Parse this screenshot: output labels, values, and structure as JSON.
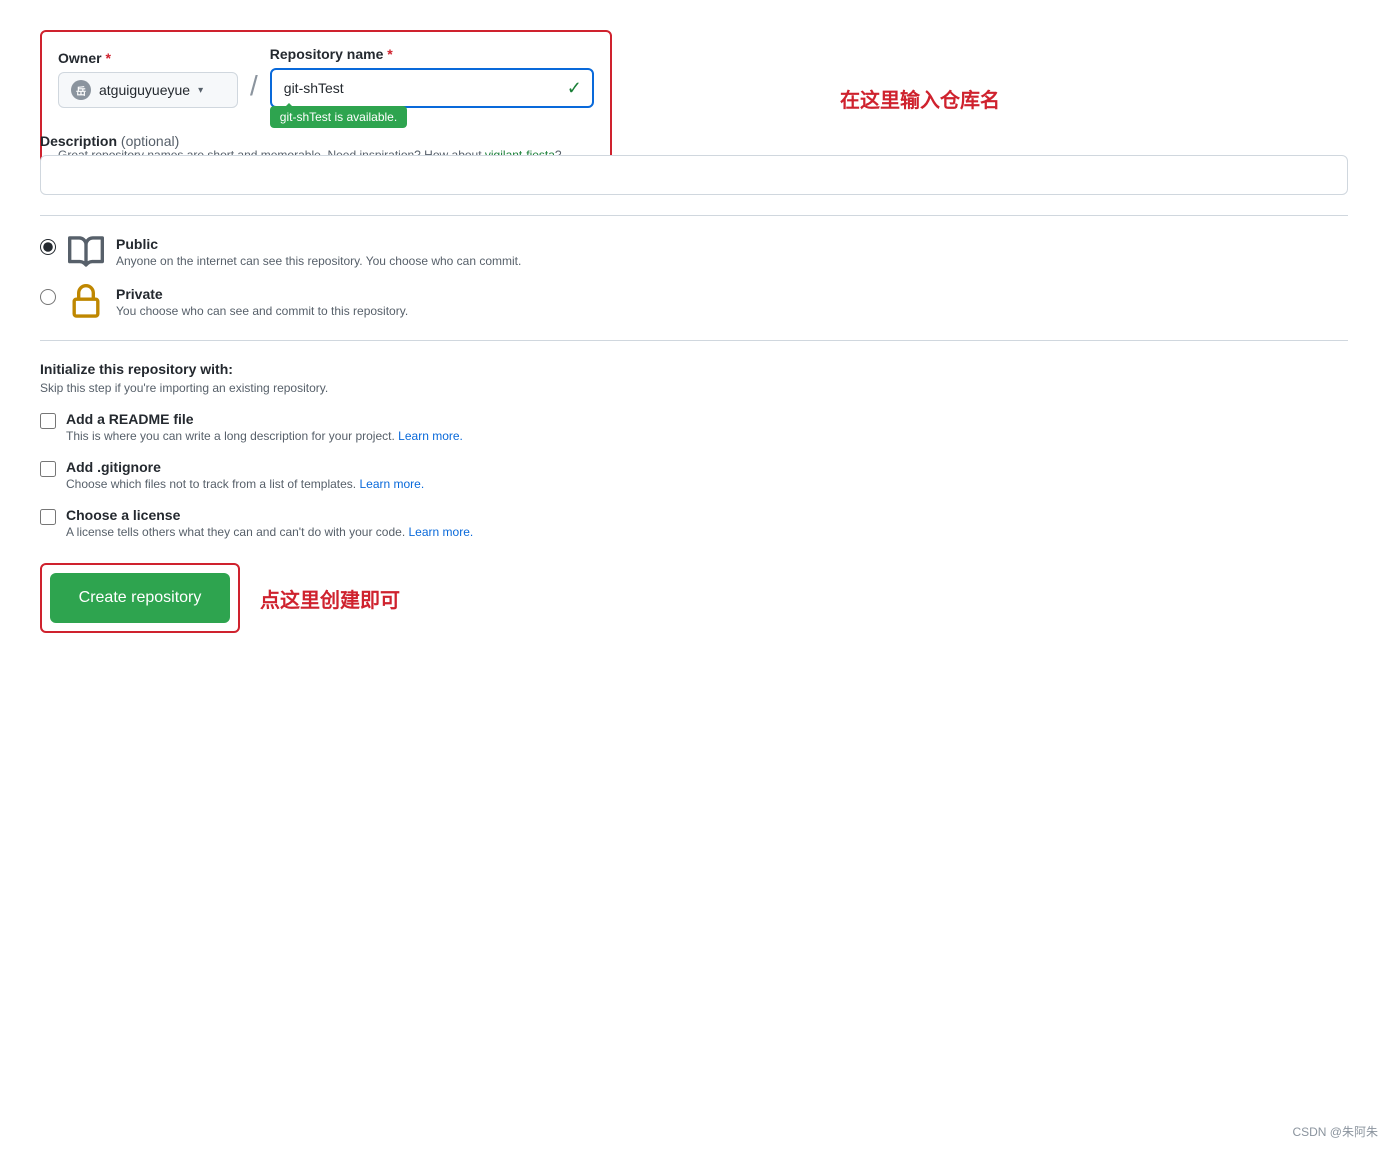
{
  "owner": {
    "label": "Owner",
    "required": true,
    "avatar_char": "岳",
    "username": "atguiguyueyue",
    "dropdown_aria": "Owner dropdown"
  },
  "repo_name": {
    "label": "Repository name",
    "required": true,
    "value": "git-shTest",
    "available_message": "git-shTest is available.",
    "hint_prefix": "Great repository names are short and memorable. Need inspiration? How about ",
    "suggestion": "vigilant-fiesta",
    "hint_suffix": "?"
  },
  "annotation_repo": "在这里输入仓库名",
  "description": {
    "label": "Description",
    "optional_text": "(optional)",
    "placeholder": "",
    "value": ""
  },
  "visibility": {
    "options": [
      {
        "id": "public",
        "label": "Public",
        "description": "Anyone on the internet can see this repository. You choose who can commit.",
        "checked": true
      },
      {
        "id": "private",
        "label": "Private",
        "description": "You choose who can see and commit to this repository.",
        "checked": false
      }
    ]
  },
  "initialize": {
    "title": "Initialize this repository with:",
    "subtitle": "Skip this step if you're importing an existing repository.",
    "options": [
      {
        "id": "readme",
        "label": "Add a README file",
        "description_prefix": "This is where you can write a long description for your project.",
        "learn_more": "Learn more.",
        "checked": false
      },
      {
        "id": "gitignore",
        "label": "Add .gitignore",
        "description_prefix": "Choose which files not to track from a list of templates.",
        "learn_more": "Learn more.",
        "checked": false
      },
      {
        "id": "license",
        "label": "Choose a license",
        "description_prefix": "A license tells others what they can and can't do with your code.",
        "learn_more": "Learn more.",
        "checked": false
      }
    ]
  },
  "create_button": {
    "label": "Create repository"
  },
  "annotation_create": "点这里创建即可",
  "watermark": "CSDN @朱阿朱"
}
